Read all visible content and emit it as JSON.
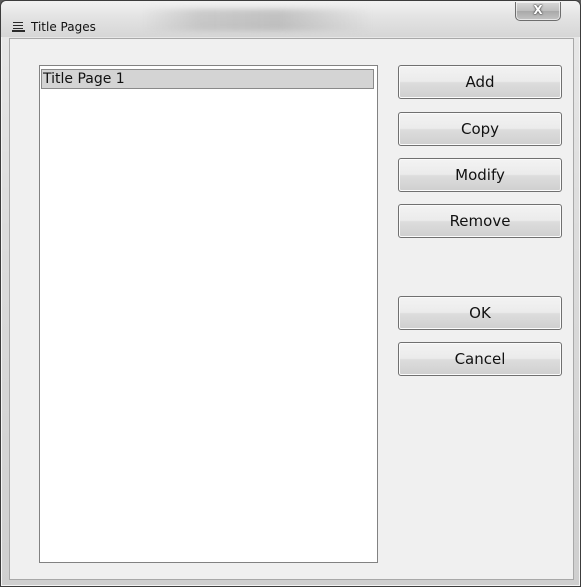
{
  "window": {
    "title": "Title Pages",
    "close_label": "X"
  },
  "list": {
    "items": [
      "Title Page 1"
    ]
  },
  "buttons": {
    "add": "Add",
    "copy": "Copy",
    "modify": "Modify",
    "remove": "Remove",
    "ok": "OK",
    "cancel": "Cancel"
  },
  "icons": {
    "app": "printer-icon",
    "close": "close-icon"
  }
}
